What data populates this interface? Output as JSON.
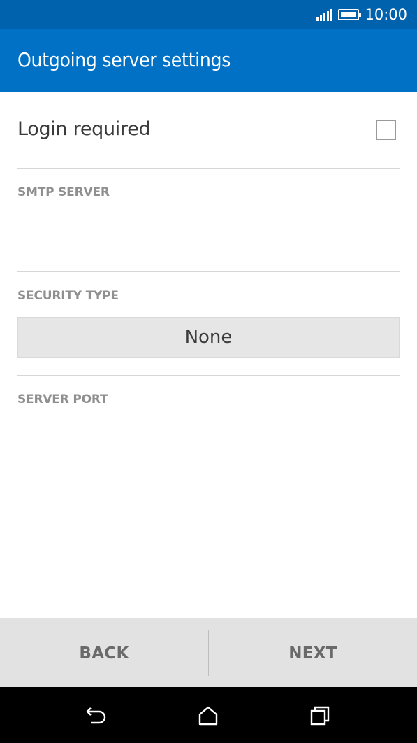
{
  "status_bar": {
    "time": "10:00",
    "signal_icon": "signal-bars-icon",
    "battery_icon": "battery-full-icon"
  },
  "app_bar": {
    "title": "Outgoing server settings"
  },
  "login": {
    "label": "Login required",
    "checked": false
  },
  "smtp_server": {
    "header": "SMTP SERVER",
    "value": ""
  },
  "security_type": {
    "header": "SECURITY TYPE",
    "selected": "None"
  },
  "server_port": {
    "header": "SERVER PORT",
    "value": ""
  },
  "actions": {
    "back_label": "BACK",
    "next_label": "NEXT"
  },
  "nav_bar": {
    "back_icon": "back-arrow-icon",
    "home_icon": "home-icon",
    "recent_icon": "recent-apps-icon"
  },
  "colors": {
    "status_bar": "#0062ad",
    "app_bar": "#0071c5",
    "input_focus_underline": "#9ad9f0",
    "section_header": "#8f8f8f"
  }
}
